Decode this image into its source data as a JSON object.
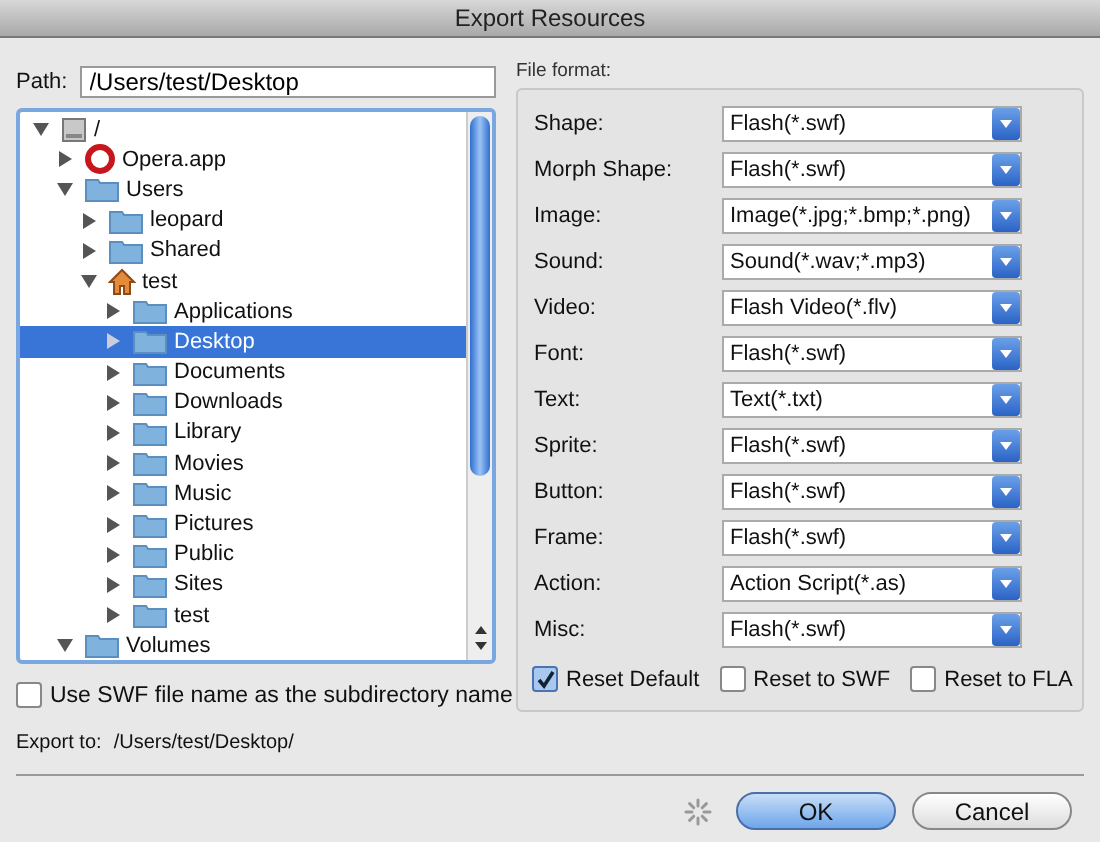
{
  "window": {
    "title": "Export Resources"
  },
  "path": {
    "label": "Path:",
    "value": "/Users/test/Desktop"
  },
  "tree": [
    {
      "label": "/",
      "kind": "disk",
      "expanded": true,
      "selected": false,
      "children": [
        {
          "label": "Opera.app",
          "kind": "app",
          "expanded": false,
          "selected": false
        },
        {
          "label": "Users",
          "kind": "folder",
          "expanded": true,
          "selected": false,
          "children": [
            {
              "label": "leopard",
              "kind": "folder",
              "expanded": false,
              "selected": false
            },
            {
              "label": "Shared",
              "kind": "folder",
              "expanded": false,
              "selected": false
            },
            {
              "label": "test",
              "kind": "home",
              "expanded": true,
              "selected": false,
              "children": [
                {
                  "label": "Applications",
                  "kind": "folder",
                  "expanded": false,
                  "selected": false
                },
                {
                  "label": "Desktop",
                  "kind": "folder",
                  "expanded": false,
                  "selected": true
                },
                {
                  "label": "Documents",
                  "kind": "folder",
                  "expanded": false,
                  "selected": false
                },
                {
                  "label": "Downloads",
                  "kind": "folder",
                  "expanded": false,
                  "selected": false
                },
                {
                  "label": "Library",
                  "kind": "folder",
                  "expanded": false,
                  "selected": false
                },
                {
                  "label": "Movies",
                  "kind": "folder",
                  "expanded": false,
                  "selected": false
                },
                {
                  "label": "Music",
                  "kind": "folder",
                  "expanded": false,
                  "selected": false
                },
                {
                  "label": "Pictures",
                  "kind": "folder",
                  "expanded": false,
                  "selected": false
                },
                {
                  "label": "Public",
                  "kind": "folder",
                  "expanded": false,
                  "selected": false
                },
                {
                  "label": "Sites",
                  "kind": "folder",
                  "expanded": false,
                  "selected": false
                },
                {
                  "label": "test",
                  "kind": "folder",
                  "expanded": false,
                  "selected": false
                }
              ]
            }
          ]
        },
        {
          "label": "Volumes",
          "kind": "folder",
          "expanded": true,
          "selected": false
        }
      ]
    }
  ],
  "subdir_option": {
    "label": "Use SWF file name as the subdirectory name",
    "checked": false
  },
  "export_to": {
    "label": "Export to:",
    "value": "/Users/test/Desktop/"
  },
  "file_format": {
    "title": "File format:",
    "rows": [
      {
        "label": "Shape:",
        "value": "Flash(*.swf)"
      },
      {
        "label": "Morph Shape:",
        "value": "Flash(*.swf)"
      },
      {
        "label": "Image:",
        "value": "Image(*.jpg;*.bmp;*.png)"
      },
      {
        "label": "Sound:",
        "value": "Sound(*.wav;*.mp3)"
      },
      {
        "label": "Video:",
        "value": "Flash Video(*.flv)"
      },
      {
        "label": "Font:",
        "value": "Flash(*.swf)"
      },
      {
        "label": "Text:",
        "value": "Text(*.txt)"
      },
      {
        "label": "Sprite:",
        "value": "Flash(*.swf)"
      },
      {
        "label": "Button:",
        "value": "Flash(*.swf)"
      },
      {
        "label": "Frame:",
        "value": "Flash(*.swf)"
      },
      {
        "label": "Action:",
        "value": "Action Script(*.as)"
      },
      {
        "label": "Misc:",
        "value": "Flash(*.swf)"
      }
    ],
    "options": [
      {
        "label": "Reset Default",
        "checked": true
      },
      {
        "label": "Reset to SWF",
        "checked": false
      },
      {
        "label": "Reset to FLA",
        "checked": false
      }
    ]
  },
  "buttons": [
    {
      "label": "OK",
      "kind": "default"
    },
    {
      "label": "Cancel",
      "kind": "normal"
    }
  ]
}
